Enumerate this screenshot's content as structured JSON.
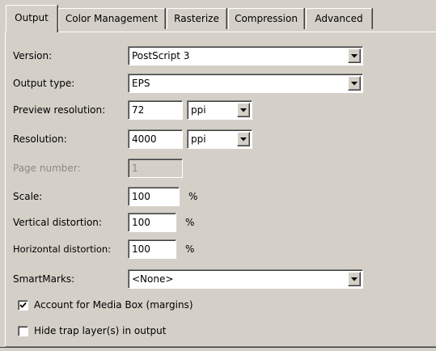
{
  "tabs": [
    {
      "label": "Output",
      "active": true
    },
    {
      "label": "Color Management",
      "active": false
    },
    {
      "label": "Rasterize",
      "active": false
    },
    {
      "label": "Compression",
      "active": false
    },
    {
      "label": "Advanced",
      "active": false
    }
  ],
  "form": {
    "version": {
      "label": "Version:",
      "value": "PostScript 3"
    },
    "output_type": {
      "label": "Output type:",
      "value": "EPS"
    },
    "preview_resolution": {
      "label": "Preview resolution:",
      "value": "72",
      "unit": "ppi"
    },
    "resolution": {
      "label": "Resolution:",
      "value": "4000",
      "unit": "ppi"
    },
    "page_number": {
      "label": "Page number:",
      "value": "1",
      "disabled": true
    },
    "scale": {
      "label": "Scale:",
      "value": "100",
      "unit": "%"
    },
    "vertical_distortion": {
      "label": "Vertical distortion:",
      "value": "100",
      "unit": "%"
    },
    "horizontal_distortion": {
      "label": "Horizontal distortion:",
      "value": "100",
      "unit": "%"
    },
    "smartmarks": {
      "label": "SmartMarks:",
      "value": "<None>"
    }
  },
  "checkboxes": {
    "account_media_box": {
      "label": "Account for Media Box (margins)",
      "checked": true
    },
    "hide_trap_layers": {
      "label": "Hide trap layer(s) in output",
      "checked": false
    }
  },
  "icons": {
    "dropdown": "chevron-down-icon",
    "check": "checkmark-icon"
  },
  "colors": {
    "face": "#d4d0c8",
    "disabled_text": "#8c8a83"
  }
}
